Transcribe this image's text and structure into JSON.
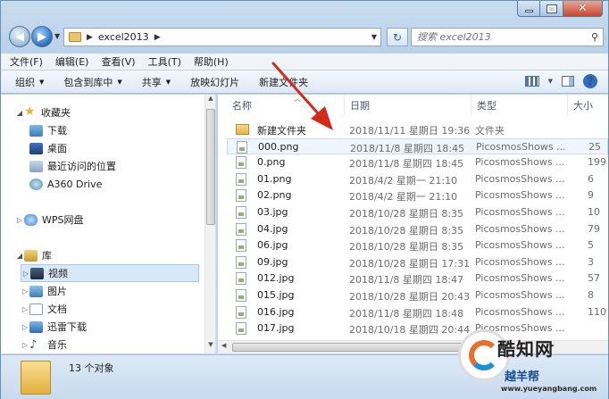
{
  "address": {
    "path": "excel2013",
    "search_placeholder": "搜索 excel2013"
  },
  "menubar": {
    "items": [
      "文件(F)",
      "编辑(E)",
      "查看(V)",
      "工具(T)",
      "帮助(H)"
    ]
  },
  "toolbar": {
    "organize": "组织",
    "include_library": "包含到库中",
    "share": "共享",
    "slideshow": "放映幻灯片",
    "new_folder": "新建文件夹"
  },
  "navpane": {
    "favorites": "收藏夹",
    "downloads": "下载",
    "desktop": "桌面",
    "recent": "最近访问的位置",
    "a360": "A360 Drive",
    "wps": "WPS网盘",
    "library": "库",
    "videos": "视频",
    "pictures": "图片",
    "documents": "文档",
    "thunder": "迅雷下载",
    "music": "音乐"
  },
  "columns": {
    "name": "名称",
    "date": "日期",
    "type": "类型",
    "size": "大小"
  },
  "files": [
    {
      "name": "新建文件夹",
      "date": "2018/11/11 星期日 19:36",
      "type": "文件夹",
      "size": "",
      "kind": "folder"
    },
    {
      "name": "000.png",
      "date": "2018/11/8 星期四 18:45",
      "type": "PicosmosShows ...",
      "size": "25",
      "kind": "img"
    },
    {
      "name": "0.png",
      "date": "2018/11/8 星期四 18:45",
      "type": "PicosmosShows ...",
      "size": "199",
      "kind": "img"
    },
    {
      "name": "01.png",
      "date": "2018/4/2 星期一 21:10",
      "type": "PicosmosShows ...",
      "size": "6",
      "kind": "img"
    },
    {
      "name": "02.png",
      "date": "2018/4/2 星期一 21:10",
      "type": "PicosmosShows ...",
      "size": "9",
      "kind": "img"
    },
    {
      "name": "03.jpg",
      "date": "2018/10/28 星期日 8:35",
      "type": "PicosmosShows ...",
      "size": "10",
      "kind": "img"
    },
    {
      "name": "04.jpg",
      "date": "2018/10/28 星期日 8:35",
      "type": "PicosmosShows ...",
      "size": "79",
      "kind": "img"
    },
    {
      "name": "06.jpg",
      "date": "2018/10/28 星期日 8:35",
      "type": "PicosmosShows ...",
      "size": "5",
      "kind": "img"
    },
    {
      "name": "09.jpg",
      "date": "2018/10/28 星期日 17:31",
      "type": "PicosmosShows ...",
      "size": "3",
      "kind": "img"
    },
    {
      "name": "012.jpg",
      "date": "2018/11/8 星期四 18:47",
      "type": "PicosmosShows ...",
      "size": "57",
      "kind": "img"
    },
    {
      "name": "015.jpg",
      "date": "2018/10/28 星期日 20:43",
      "type": "PicosmosShows ...",
      "size": "8",
      "kind": "img"
    },
    {
      "name": "016.jpg",
      "date": "2018/11/8 星期四 18:48",
      "type": "PicosmosShows ...",
      "size": "110",
      "kind": "img"
    },
    {
      "name": "017.jpg",
      "date": "2018/10/18 星期四 20:44",
      "type": "PicosmosShows ...",
      "size": "",
      "kind": "img"
    }
  ],
  "details": {
    "count": "13 个对象"
  },
  "watermark": {
    "logo_text": "酷知网",
    "sub_text": "越羊帮",
    "url": "www.yueyangbang.com"
  }
}
